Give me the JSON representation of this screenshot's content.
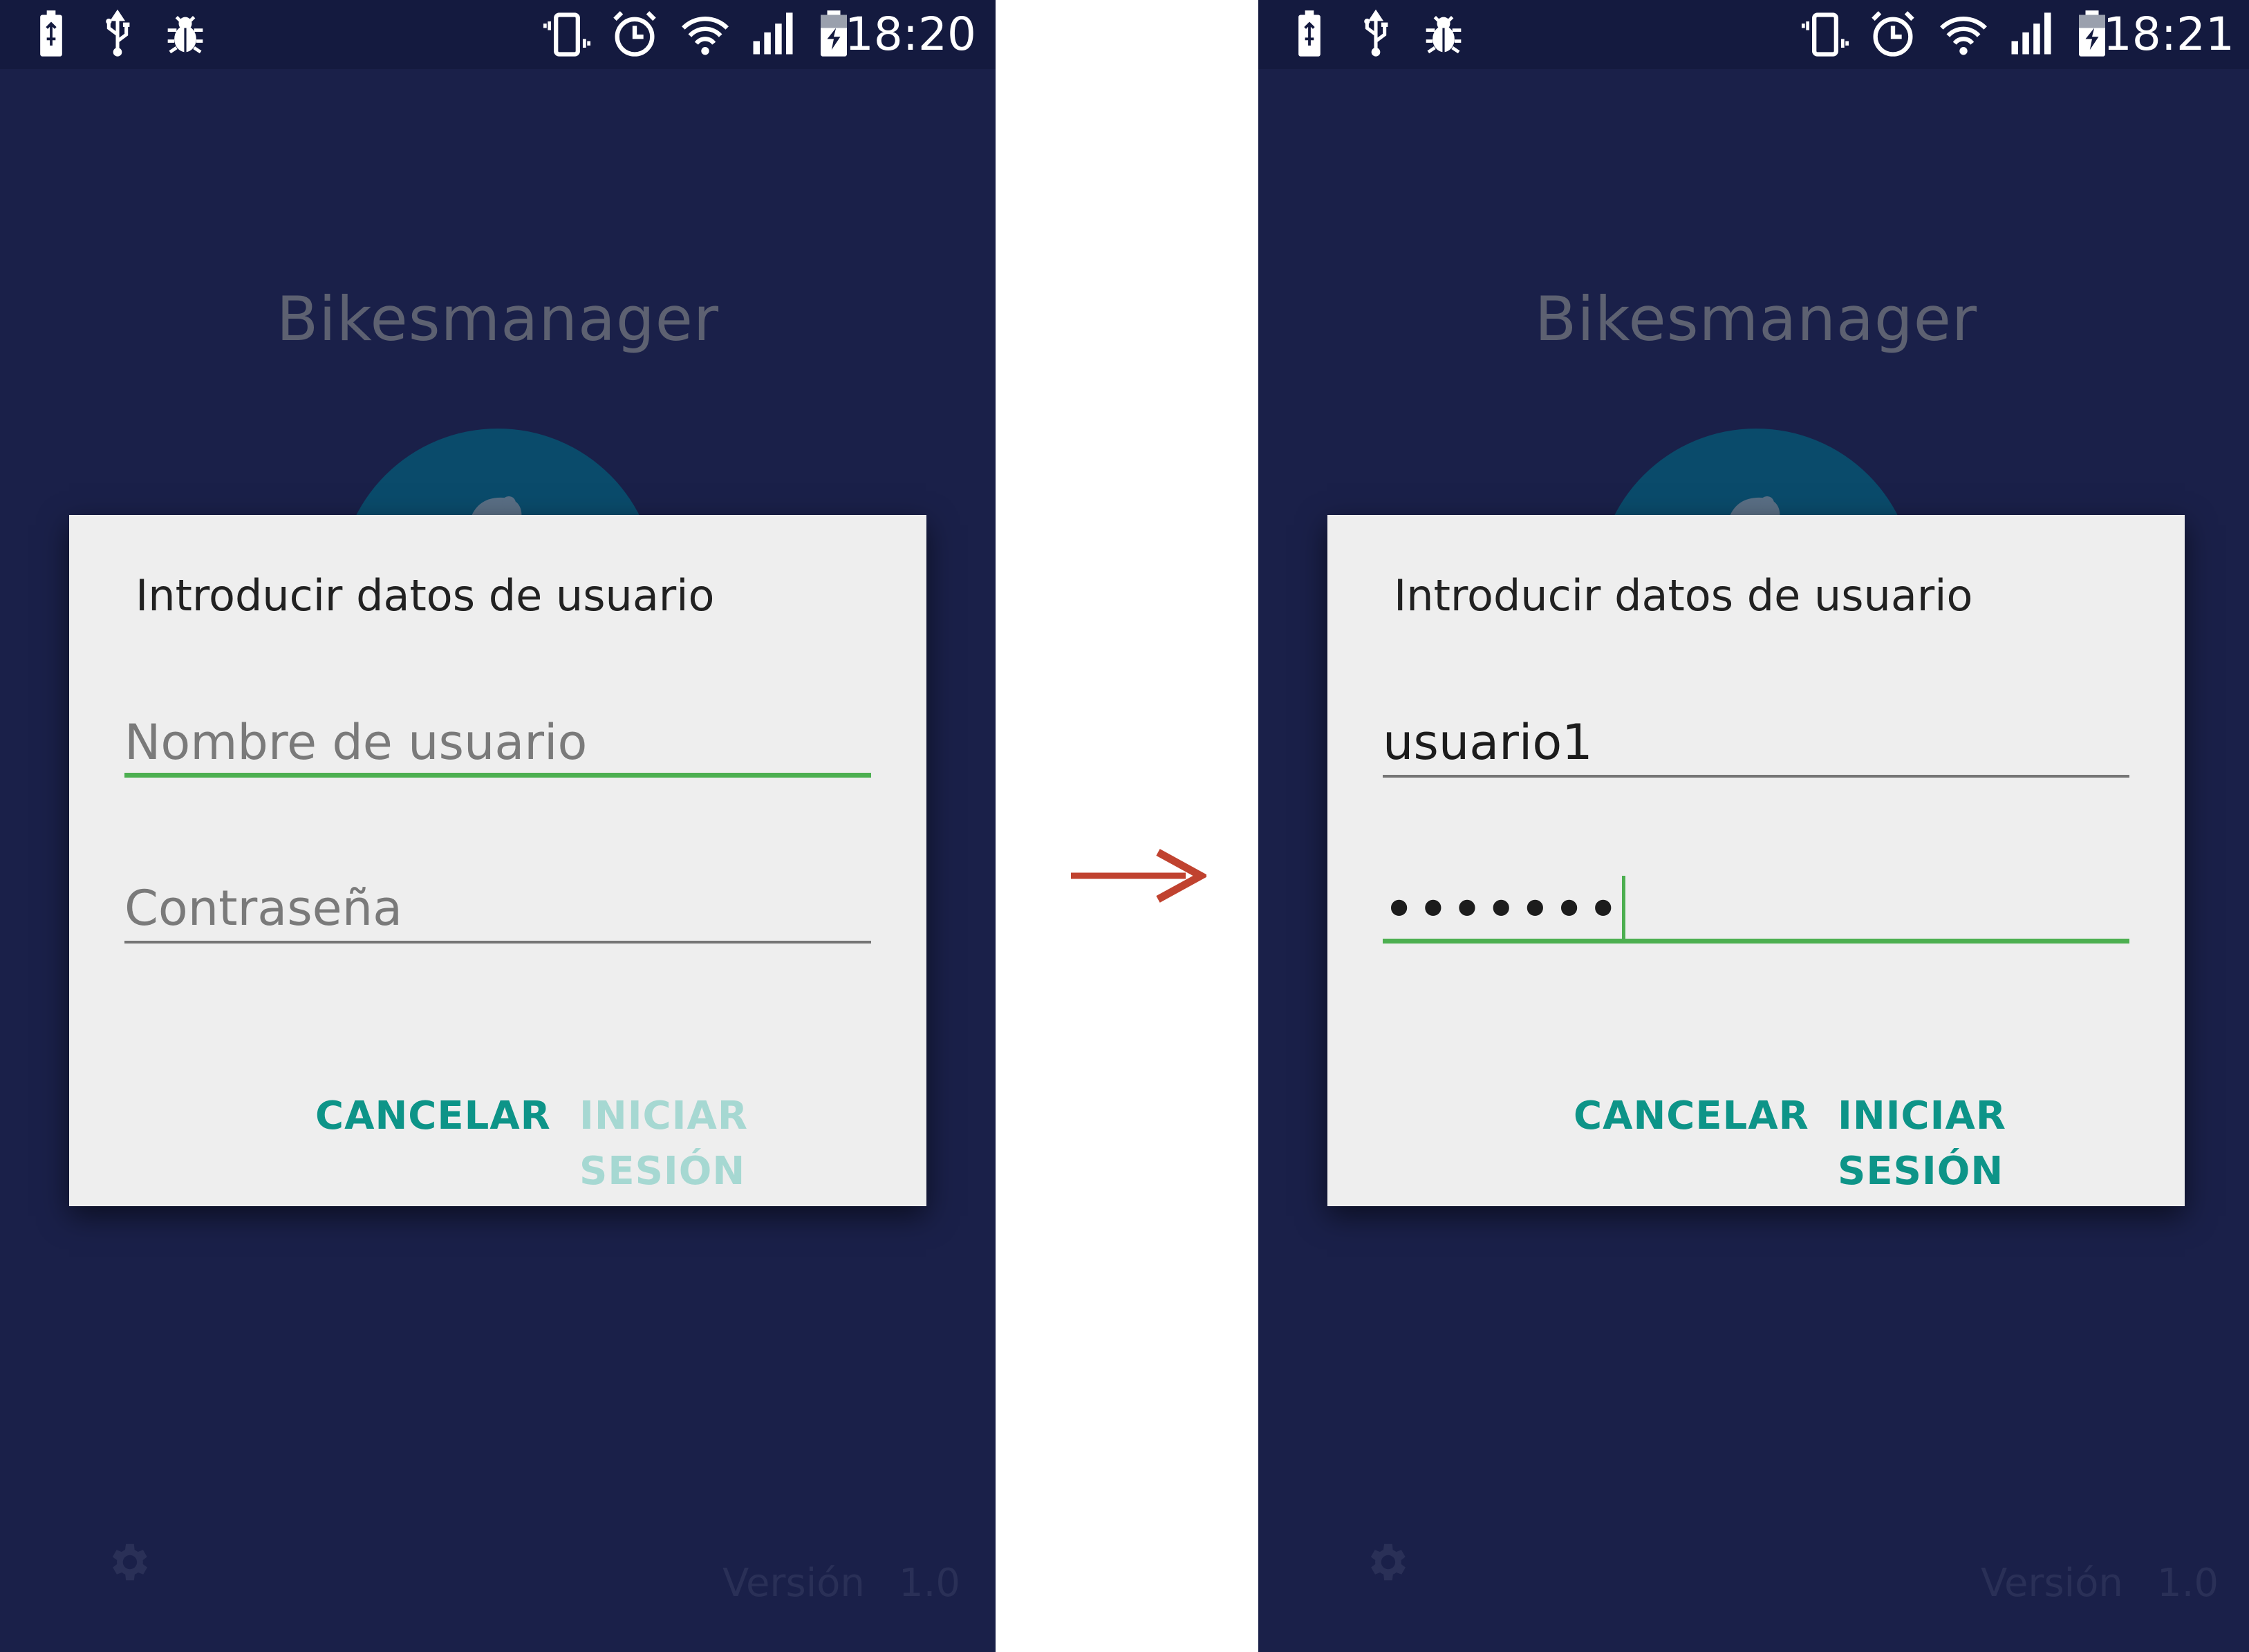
{
  "arrow_color": "#c0422f",
  "screens": [
    {
      "status_bar": {
        "time": "18:20"
      },
      "app_title": "Bikesmanager",
      "dialog": {
        "title": "Introducir datos de usuario",
        "username": {
          "value": "",
          "placeholder": "Nombre de usuario",
          "focused": true
        },
        "password": {
          "value": "",
          "placeholder": "Contraseña",
          "focused": false
        },
        "cancel_label": "CANCELAR",
        "login_label": "INICIAR SESIÓN",
        "login_enabled": false
      },
      "footer": {
        "version_label": "Versión",
        "version_number": "1.0"
      }
    },
    {
      "status_bar": {
        "time": "18:21"
      },
      "app_title": "Bikesmanager",
      "dialog": {
        "title": "Introducir datos de usuario",
        "username": {
          "value": "usuario1",
          "placeholder": "Nombre de usuario",
          "focused": false
        },
        "password": {
          "value": "•••••••",
          "placeholder": "Contraseña",
          "focused": true
        },
        "cancel_label": "CANCELAR",
        "login_label": "INICIAR SESIÓN",
        "login_enabled": true
      },
      "footer": {
        "version_label": "Versión",
        "version_number": "1.0"
      }
    }
  ]
}
